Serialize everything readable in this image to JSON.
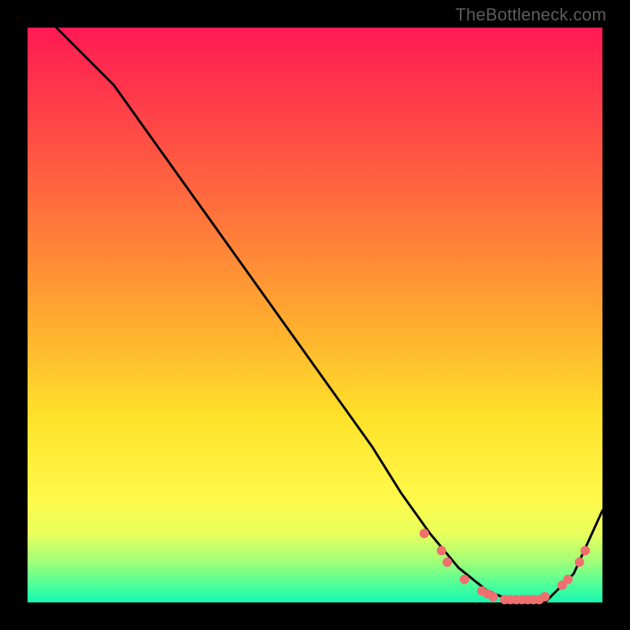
{
  "watermark": "TheBottleneck.com",
  "chart_data": {
    "type": "line",
    "title": "",
    "xlabel": "",
    "ylabel": "",
    "xlim": [
      0,
      100
    ],
    "ylim": [
      0,
      100
    ],
    "grid": false,
    "legend": false,
    "series": [
      {
        "name": "curve",
        "color": "#000000",
        "x": [
          5,
          10,
          15,
          20,
          25,
          30,
          35,
          40,
          45,
          50,
          55,
          60,
          65,
          70,
          75,
          80,
          85,
          90,
          95,
          100
        ],
        "y": [
          100,
          95,
          90,
          83,
          76,
          69,
          62,
          55,
          48,
          41,
          34,
          27,
          19,
          12,
          6,
          2,
          0,
          0,
          5,
          16
        ]
      }
    ],
    "markers": {
      "name": "dots",
      "color": "#ef6f6f",
      "radius_px": 6,
      "points": [
        {
          "x": 69,
          "y": 12
        },
        {
          "x": 72,
          "y": 9
        },
        {
          "x": 73,
          "y": 7
        },
        {
          "x": 76,
          "y": 4
        },
        {
          "x": 79,
          "y": 2
        },
        {
          "x": 80,
          "y": 1.5
        },
        {
          "x": 81,
          "y": 1
        },
        {
          "x": 83,
          "y": 0.5
        },
        {
          "x": 84,
          "y": 0.5
        },
        {
          "x": 85,
          "y": 0.5
        },
        {
          "x": 86,
          "y": 0.5
        },
        {
          "x": 87,
          "y": 0.5
        },
        {
          "x": 88,
          "y": 0.5
        },
        {
          "x": 89,
          "y": 0.5
        },
        {
          "x": 90,
          "y": 1
        },
        {
          "x": 93,
          "y": 3
        },
        {
          "x": 94,
          "y": 4
        },
        {
          "x": 96,
          "y": 7
        },
        {
          "x": 97,
          "y": 9
        }
      ]
    },
    "background_gradient": {
      "top": "#ff1a53",
      "mid1": "#ffae2f",
      "mid2": "#fff94a",
      "bottom": "#17f7b0"
    }
  }
}
